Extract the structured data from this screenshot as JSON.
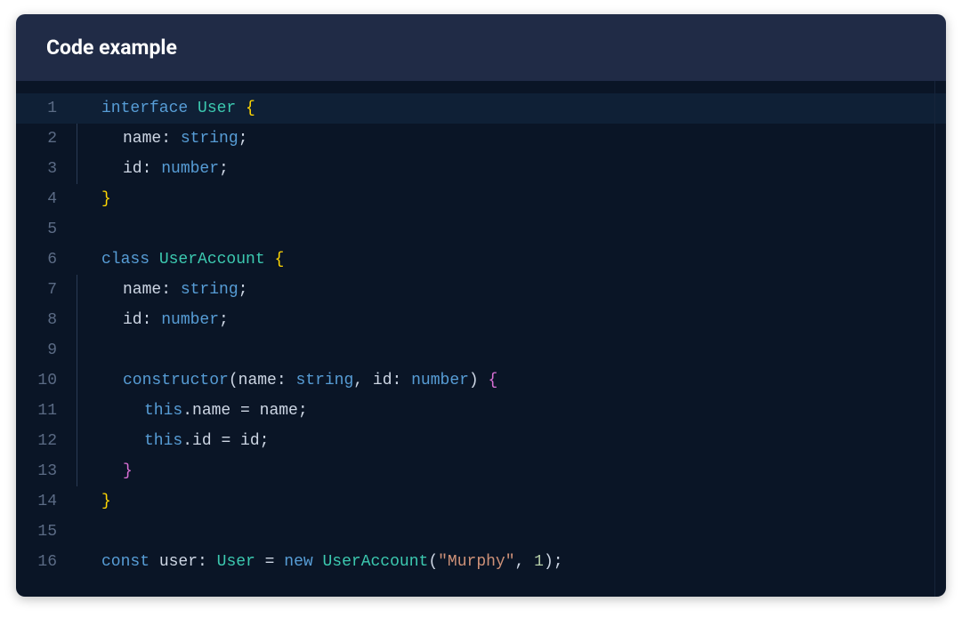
{
  "header": {
    "title": "Code example"
  },
  "colors": {
    "panel_header_bg": "#202b46",
    "code_bg": "#0a1526",
    "highlight_bg": "#0f2036",
    "line_number": "#5b6b85",
    "keyword": "#579dd6",
    "type": "#3cc9b0",
    "brace_yellow": "#ffd602",
    "brace_pink": "#da70d6",
    "string": "#ce9178",
    "number_lit": "#b5cea8",
    "default_text": "#cdd6e4"
  },
  "lines": [
    {
      "n": 1,
      "hl": true,
      "bar": false,
      "indent": 0,
      "tokens": [
        {
          "t": "interface ",
          "c": "kw"
        },
        {
          "t": "User ",
          "c": "type"
        },
        {
          "t": "{",
          "c": "brY"
        }
      ]
    },
    {
      "n": 2,
      "hl": false,
      "bar": true,
      "indent": 1,
      "tokens": [
        {
          "t": "name",
          "c": "id"
        },
        {
          "t": ": ",
          "c": "pun"
        },
        {
          "t": "string",
          "c": "prim"
        },
        {
          "t": ";",
          "c": "pun"
        }
      ]
    },
    {
      "n": 3,
      "hl": false,
      "bar": true,
      "indent": 1,
      "tokens": [
        {
          "t": "id",
          "c": "id"
        },
        {
          "t": ": ",
          "c": "pun"
        },
        {
          "t": "number",
          "c": "prim"
        },
        {
          "t": ";",
          "c": "pun"
        }
      ]
    },
    {
      "n": 4,
      "hl": false,
      "bar": false,
      "indent": 0,
      "tokens": [
        {
          "t": "}",
          "c": "brY"
        }
      ]
    },
    {
      "n": 5,
      "hl": false,
      "bar": false,
      "indent": 0,
      "tokens": []
    },
    {
      "n": 6,
      "hl": false,
      "bar": false,
      "indent": 0,
      "tokens": [
        {
          "t": "class ",
          "c": "kw"
        },
        {
          "t": "UserAccount ",
          "c": "type"
        },
        {
          "t": "{",
          "c": "brY"
        }
      ]
    },
    {
      "n": 7,
      "hl": false,
      "bar": true,
      "indent": 1,
      "tokens": [
        {
          "t": "name",
          "c": "id"
        },
        {
          "t": ": ",
          "c": "pun"
        },
        {
          "t": "string",
          "c": "prim"
        },
        {
          "t": ";",
          "c": "pun"
        }
      ]
    },
    {
      "n": 8,
      "hl": false,
      "bar": true,
      "indent": 1,
      "tokens": [
        {
          "t": "id",
          "c": "id"
        },
        {
          "t": ": ",
          "c": "pun"
        },
        {
          "t": "number",
          "c": "prim"
        },
        {
          "t": ";",
          "c": "pun"
        }
      ]
    },
    {
      "n": 9,
      "hl": false,
      "bar": true,
      "indent": 0,
      "tokens": []
    },
    {
      "n": 10,
      "hl": false,
      "bar": true,
      "indent": 1,
      "tokens": [
        {
          "t": "constructor",
          "c": "kw"
        },
        {
          "t": "(",
          "c": "pun"
        },
        {
          "t": "name",
          "c": "id"
        },
        {
          "t": ": ",
          "c": "pun"
        },
        {
          "t": "string",
          "c": "prim"
        },
        {
          "t": ", ",
          "c": "pun"
        },
        {
          "t": "id",
          "c": "id"
        },
        {
          "t": ": ",
          "c": "pun"
        },
        {
          "t": "number",
          "c": "prim"
        },
        {
          "t": ") ",
          "c": "pun"
        },
        {
          "t": "{",
          "c": "brP"
        }
      ]
    },
    {
      "n": 11,
      "hl": false,
      "bar": true,
      "indent": 2,
      "tokens": [
        {
          "t": "this",
          "c": "kw"
        },
        {
          "t": ".",
          "c": "pun"
        },
        {
          "t": "name",
          "c": "id"
        },
        {
          "t": " = ",
          "c": "pun"
        },
        {
          "t": "name",
          "c": "id"
        },
        {
          "t": ";",
          "c": "pun"
        }
      ]
    },
    {
      "n": 12,
      "hl": false,
      "bar": true,
      "indent": 2,
      "tokens": [
        {
          "t": "this",
          "c": "kw"
        },
        {
          "t": ".",
          "c": "pun"
        },
        {
          "t": "id",
          "c": "id"
        },
        {
          "t": " = ",
          "c": "pun"
        },
        {
          "t": "id",
          "c": "id"
        },
        {
          "t": ";",
          "c": "pun"
        }
      ]
    },
    {
      "n": 13,
      "hl": false,
      "bar": true,
      "indent": 1,
      "tokens": [
        {
          "t": "}",
          "c": "brP"
        }
      ]
    },
    {
      "n": 14,
      "hl": false,
      "bar": false,
      "indent": 0,
      "tokens": [
        {
          "t": "}",
          "c": "brY"
        }
      ]
    },
    {
      "n": 15,
      "hl": false,
      "bar": false,
      "indent": 0,
      "tokens": []
    },
    {
      "n": 16,
      "hl": false,
      "bar": false,
      "indent": 0,
      "tokens": [
        {
          "t": "const ",
          "c": "kw"
        },
        {
          "t": "user",
          "c": "id"
        },
        {
          "t": ": ",
          "c": "pun"
        },
        {
          "t": "User",
          "c": "type"
        },
        {
          "t": " = ",
          "c": "pun"
        },
        {
          "t": "new ",
          "c": "kw"
        },
        {
          "t": "UserAccount",
          "c": "type"
        },
        {
          "t": "(",
          "c": "pun"
        },
        {
          "t": "\"Murphy\"",
          "c": "str"
        },
        {
          "t": ", ",
          "c": "pun"
        },
        {
          "t": "1",
          "c": "num"
        },
        {
          "t": ");",
          "c": "pun"
        }
      ]
    }
  ]
}
